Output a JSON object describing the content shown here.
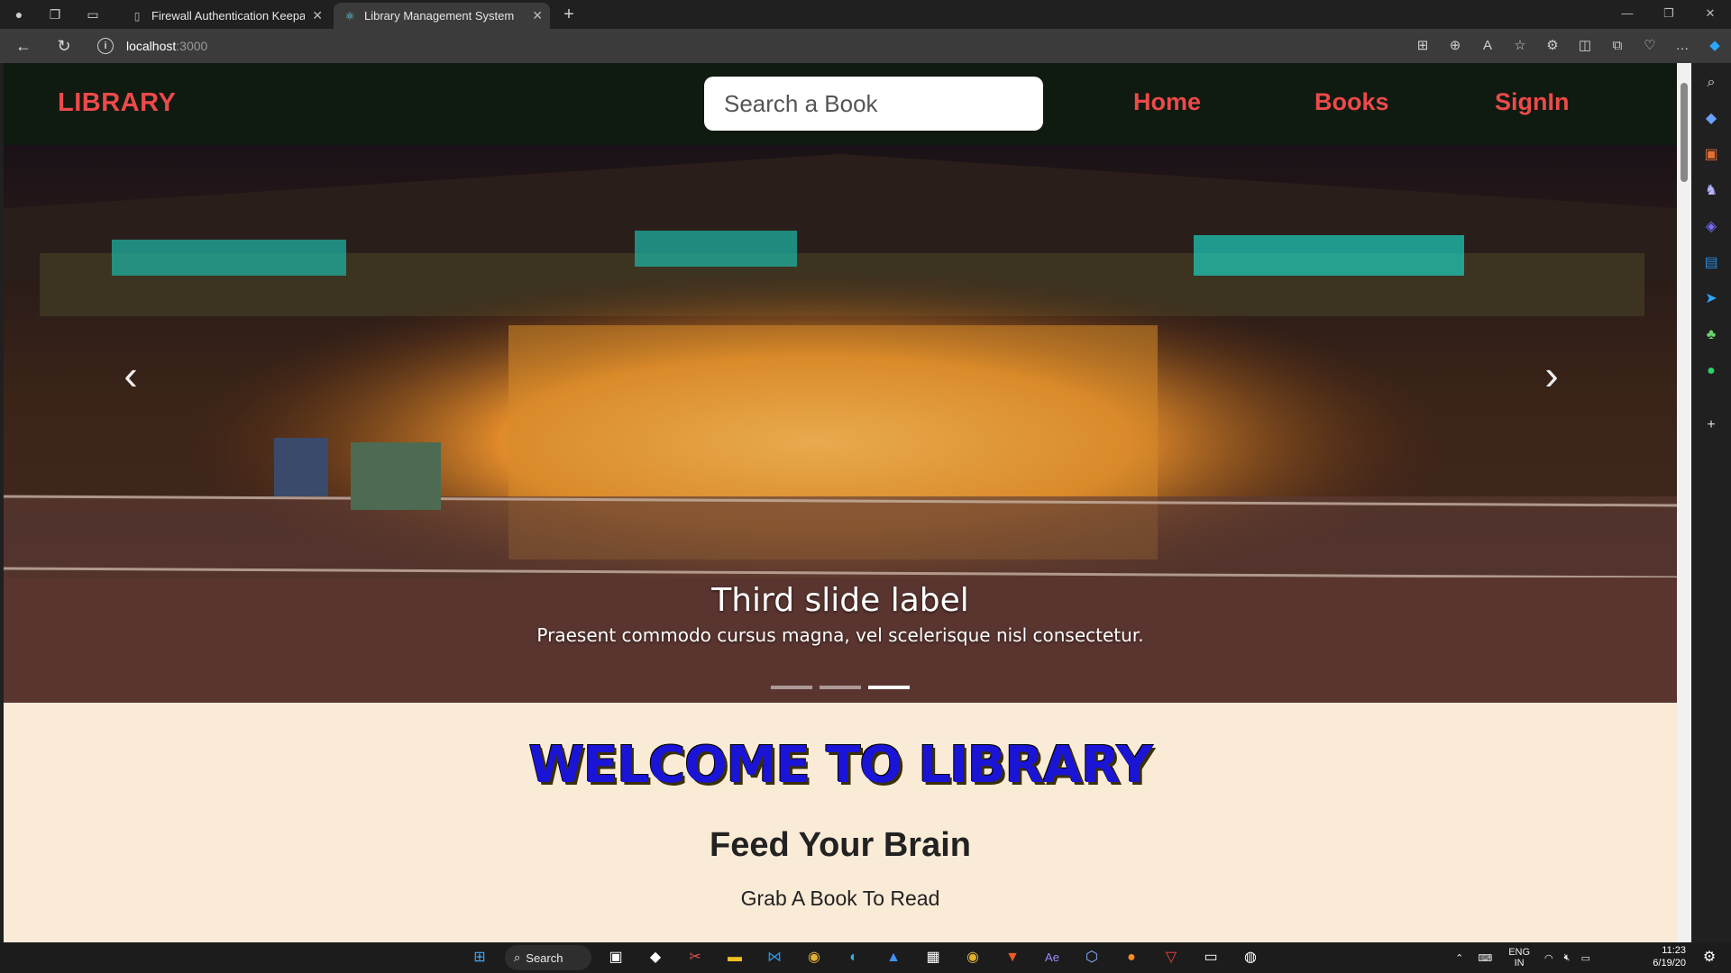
{
  "browser": {
    "tabs": [
      {
        "title": "Firewall Authentication Keepalive",
        "active": false
      },
      {
        "title": "Library Management System",
        "active": true
      }
    ],
    "url_host": "localhost",
    "url_port": ":3000"
  },
  "page": {
    "brand": "LIBRARY",
    "search_placeholder": "Search a Book",
    "nav": [
      "Home",
      "Books",
      "SignIn"
    ],
    "carousel": {
      "caption_title": "Third slide label",
      "caption_text": "Praesent commodo cursus magna, vel scelerisque nisl consectetur.",
      "indicator_count": 3,
      "active_index": 2
    },
    "welcome": "WELCOME TO LIBRARY",
    "tagline": "Feed Your Brain",
    "subline": "Grab A Book To Read"
  },
  "taskbar": {
    "search_label": "Search",
    "lang_top": "ENG",
    "lang_bottom": "IN",
    "time": "11:23",
    "date": "6/19/20"
  },
  "colors": {
    "navbar_bg": "#0f1a10",
    "brand_red": "#ec4a4a",
    "page_bg": "#faebd7",
    "welcome_blue": "#1a14d6"
  }
}
